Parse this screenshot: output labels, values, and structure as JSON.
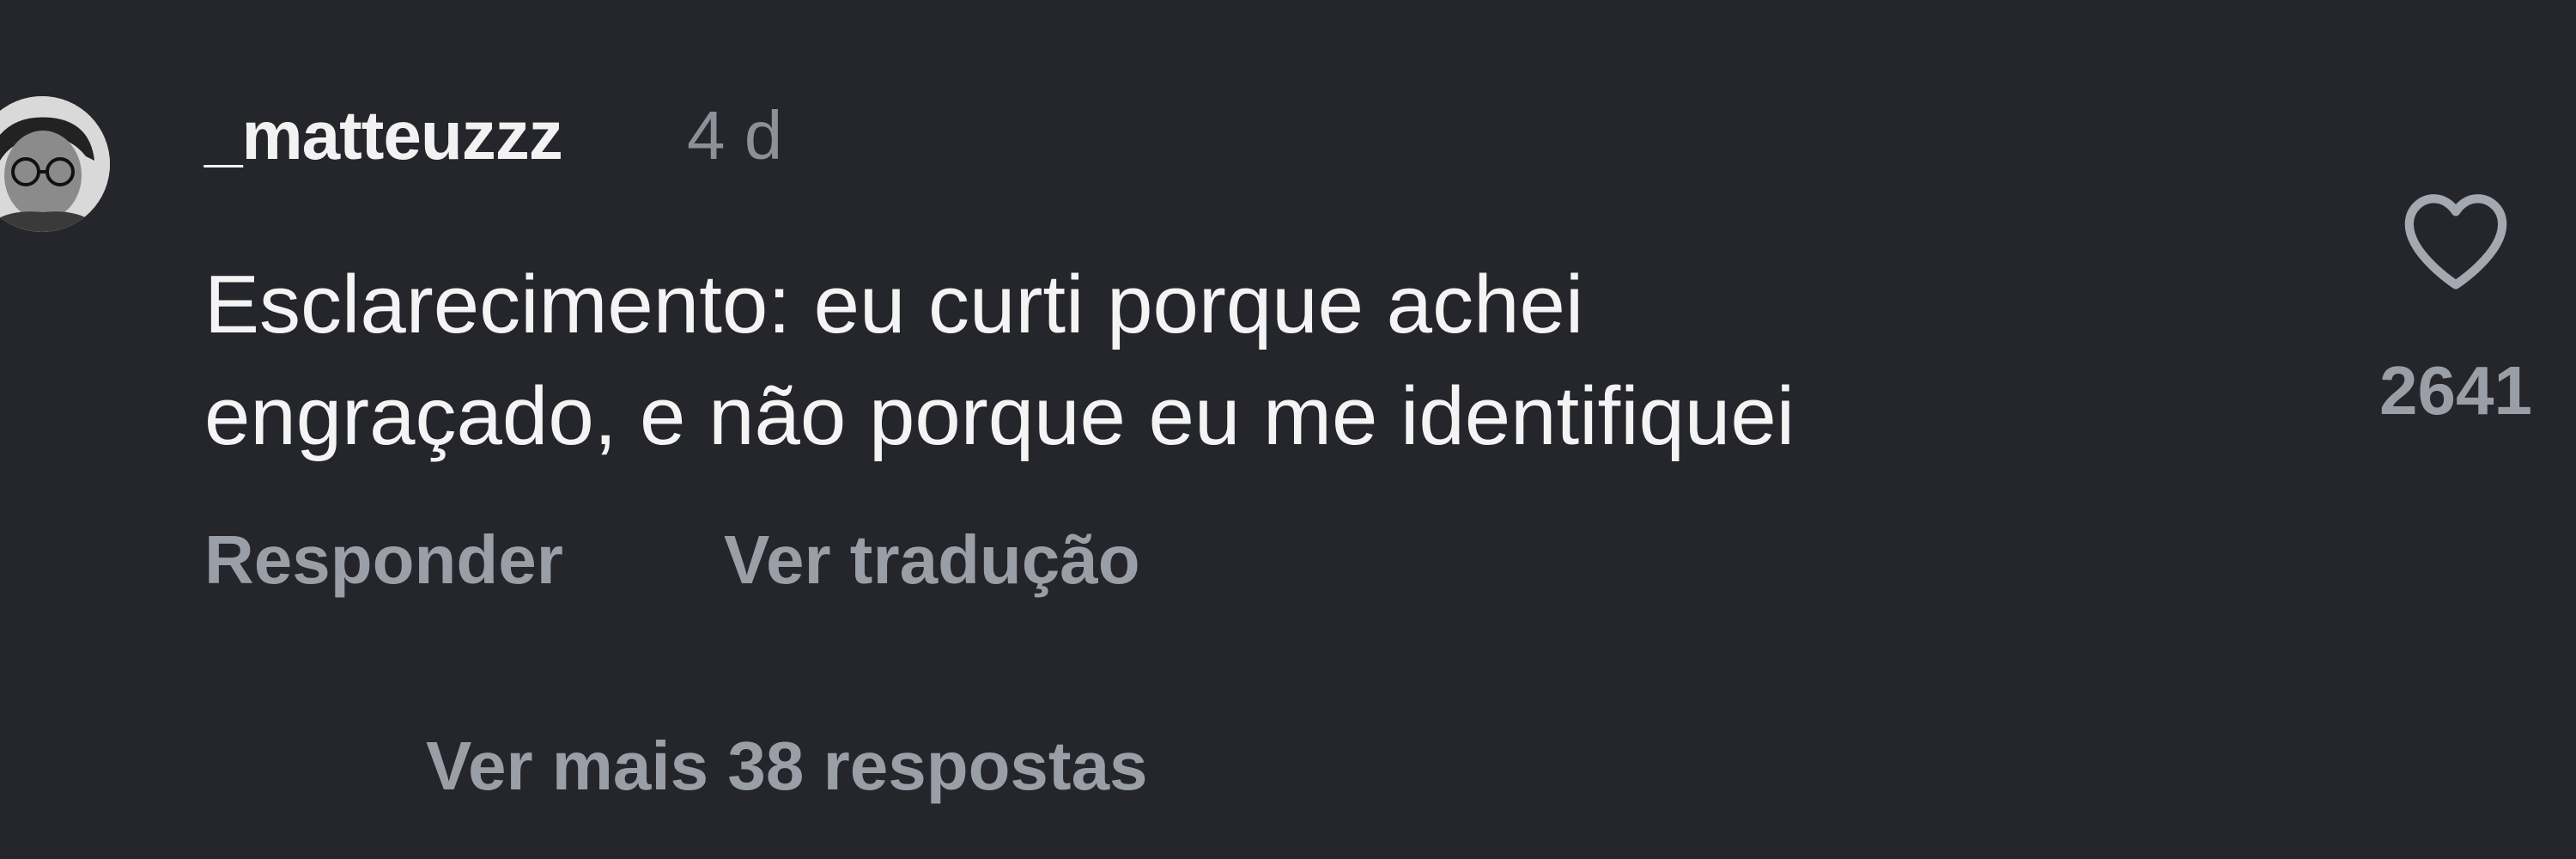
{
  "comment": {
    "username": "_matteuzzz",
    "time": "4 d",
    "text_lines": [
      "Esclarecimento: eu curti porque achei",
      "engraçado, e não porque eu me identifiquei"
    ],
    "actions": {
      "reply_label": "Responder",
      "translate_label": "Ver tradução"
    },
    "more_replies_label": "Ver mais 38 respostas",
    "like": {
      "icon": "heart-outline-icon",
      "count": "2641"
    }
  },
  "colors": {
    "background": "#24262b",
    "text_primary": "#f4f4f4",
    "text_secondary": "#9a9ea6"
  }
}
